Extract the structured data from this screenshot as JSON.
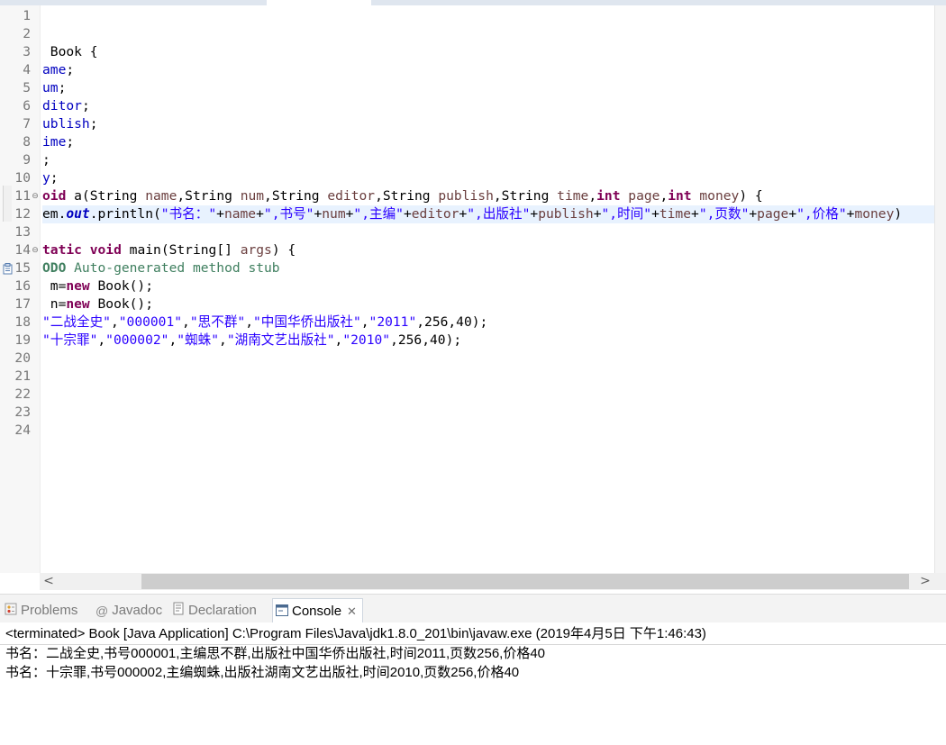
{
  "editor": {
    "line_numbers": [
      "1",
      "2",
      "3",
      "4",
      "5",
      "6",
      "7",
      "8",
      "9",
      "10",
      "11",
      "12",
      "13",
      "14",
      "15",
      "16",
      "17",
      "18",
      "19",
      "20",
      "21",
      "22",
      "23",
      "24"
    ],
    "code": {
      "l3": " Book {",
      "l4": [
        "ame",
        ";"
      ],
      "l5": [
        "um",
        ";"
      ],
      "l6": [
        "ditor",
        ";"
      ],
      "l7": [
        "ublish",
        ";"
      ],
      "l8": [
        "ime",
        ";"
      ],
      "l9": ";",
      "l10": [
        "y",
        ";"
      ],
      "l11": [
        "oid",
        " a(String ",
        "name",
        ",String ",
        "num",
        ",String ",
        "editor",
        ",String ",
        "publish",
        ",String ",
        "time",
        ",",
        "int",
        " ",
        "page",
        ",",
        "int",
        " ",
        "money",
        ") {"
      ],
      "l12": [
        "em.",
        "out",
        ".println(",
        "\"书名：\"",
        "+",
        "name",
        "+",
        "\",书号\"",
        "+",
        "num",
        "+",
        "\",主编\"",
        "+",
        "editor",
        "+",
        "\",出版社\"",
        "+",
        "publish",
        "+",
        "\",时间\"",
        "+",
        "time",
        "+",
        "\",页数\"",
        "+",
        "page",
        "+",
        "\",价格\"",
        "+",
        "money",
        ")"
      ],
      "l14": [
        "tatic",
        " ",
        "void",
        " main(String[] ",
        "args",
        ") {"
      ],
      "l15": [
        "ODO",
        " Auto-generated method stub"
      ],
      "l16": [
        " m=",
        "new",
        " Book();"
      ],
      "l17": [
        " n=",
        "new",
        " Book();"
      ],
      "l18": [
        "\"二战全史\"",
        ",",
        "\"000001\"",
        ",",
        "\"思不群\"",
        ",",
        "\"中国华侨出版社\"",
        ",",
        "\"2011\"",
        ",256,40);"
      ],
      "l19": [
        "\"十宗罪\"",
        ",",
        "\"000002\"",
        ",",
        "\"蜘蛛\"",
        ",",
        "\"湖南文艺出版社\"",
        ",",
        "\"2010\"",
        ",256,40);"
      ]
    }
  },
  "scrollbar": {
    "left_arrow": "<",
    "right_arrow": ">"
  },
  "view_tabs": {
    "problems": "Problems",
    "javadoc": "Javadoc",
    "declaration": "Declaration",
    "console": "Console",
    "close": "✕"
  },
  "console": {
    "header": "<terminated> Book [Java Application] C:\\Program Files\\Java\\jdk1.8.0_201\\bin\\javaw.exe (2019年4月5日 下午1:46:43)",
    "output": [
      "书名：二战全史,书号000001,主编思不群,出版社中国华侨出版社,时间2011,页数256,价格40",
      "书名：十宗罪,书号000002,主编蜘蛛,出版社湖南文艺出版社,时间2010,页数256,价格40"
    ]
  },
  "colors": {
    "keyword": "#7f0055",
    "field": "#0000c0",
    "string": "#2a00ff",
    "parameter": "#6a3e3e",
    "comment": "#3f7f5f",
    "current_line": "#e8f2fe"
  }
}
